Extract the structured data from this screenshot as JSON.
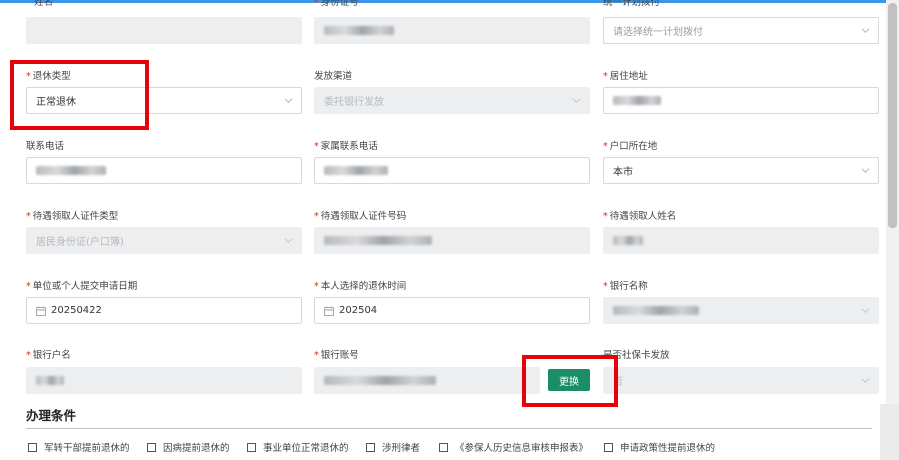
{
  "fields": {
    "name": {
      "label": "姓名"
    },
    "id_number": {
      "label": "身份证号"
    },
    "unified_plan": {
      "label": "统一计划拨付",
      "placeholder": "请选择统一计划拨付"
    },
    "retire_type": {
      "label": "退休类型",
      "value": "正常退休"
    },
    "channel": {
      "label": "发放渠道",
      "value": "委托银行发放"
    },
    "address": {
      "label": "居住地址"
    },
    "phone": {
      "label": "联系电话"
    },
    "family_phone": {
      "label": "家属联系电话"
    },
    "hukou": {
      "label": "户口所在地",
      "value": "本市"
    },
    "receiver_id_type": {
      "label": "待遇领取人证件类型",
      "value": "居民身份证(户口簿)"
    },
    "receiver_id_number": {
      "label": "待遇领取人证件号码"
    },
    "receiver_name": {
      "label": "待遇领取人姓名"
    },
    "apply_date": {
      "label": "单位或个人提交申请日期",
      "value": "20250422"
    },
    "retire_time": {
      "label": "本人选择的退休时间",
      "value": "202504"
    },
    "bank_name": {
      "label": "银行名称"
    },
    "account_name": {
      "label": "银行户名"
    },
    "account_number": {
      "label": "银行账号"
    },
    "social_card": {
      "label": "是否社保卡发放",
      "value": "否"
    }
  },
  "swap_button": "更换",
  "section": {
    "title": "办理条件"
  },
  "conditions": [
    "军转干部提前退休的",
    "因病提前退休的",
    "事业单位正常退休的",
    "涉刑律者",
    "《参保人历史信息审核申报表》",
    "申请政策性提前退休的"
  ],
  "icons": {
    "dropdown": "chevron-down-icon",
    "date": "calendar-icon"
  },
  "colors": {
    "accent": "#3c96e8",
    "button": "#1a8f67",
    "highlight": "#e8000b",
    "required": "#e2231a"
  }
}
